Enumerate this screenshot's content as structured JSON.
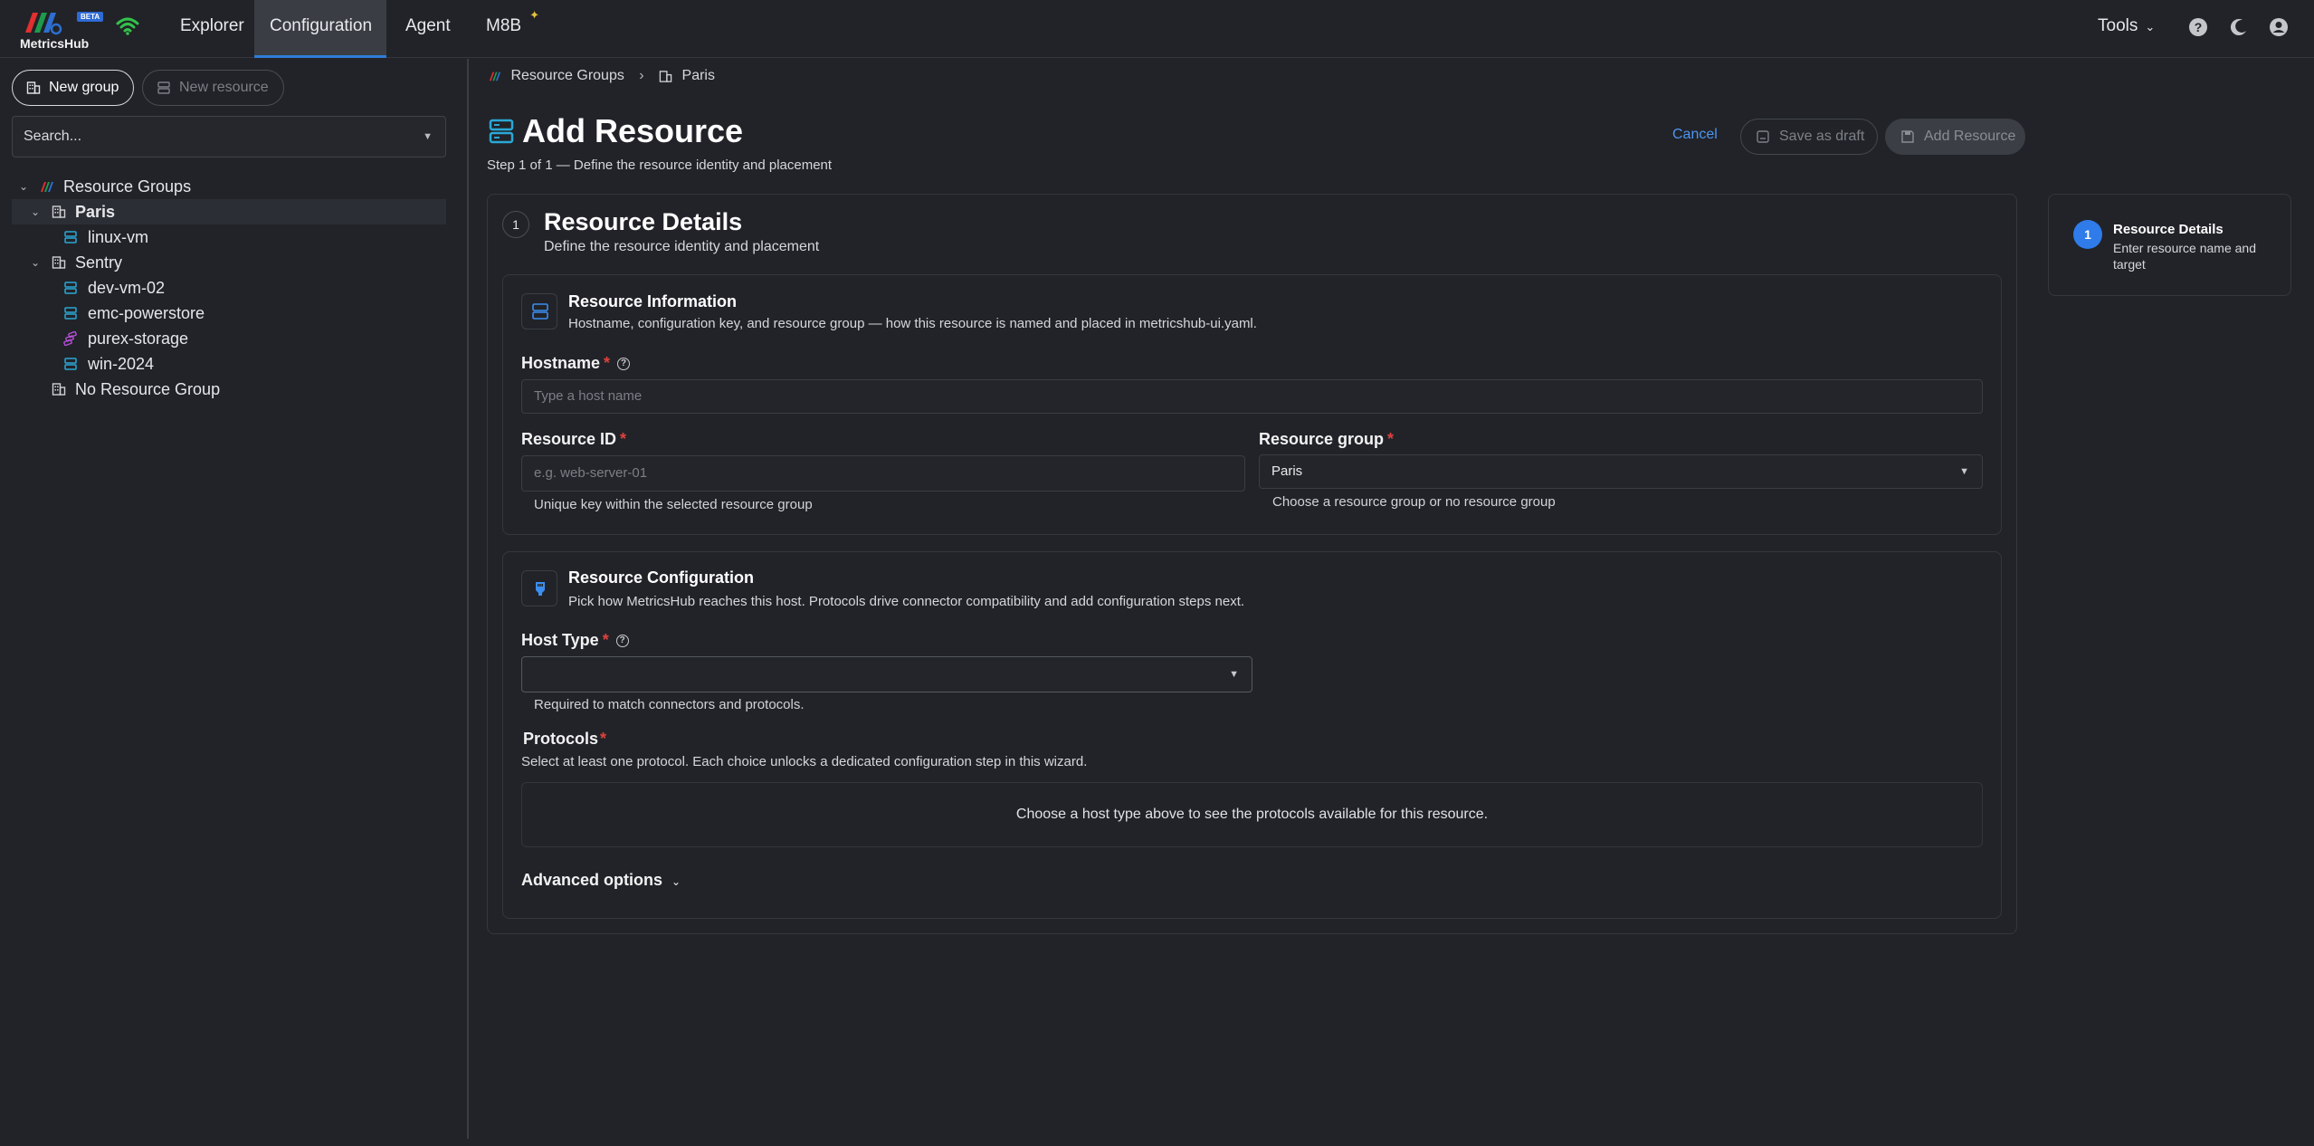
{
  "app": {
    "logo_text": "MetricsHub",
    "beta_badge": "BETA"
  },
  "nav": {
    "items": [
      {
        "label": "Explorer"
      },
      {
        "label": "Configuration"
      },
      {
        "label": "Agent"
      },
      {
        "label": "M8B"
      }
    ],
    "active": "Configuration",
    "tools_label": "Tools"
  },
  "sidebar": {
    "new_group_label": "New group",
    "new_resource_label": "New resource",
    "search_placeholder": "Search...",
    "tree": [
      {
        "label": "Resource Groups",
        "icon": "resource-groups-logo-icon"
      },
      {
        "label": "Paris",
        "icon": "building-icon",
        "selected": true
      },
      {
        "label": "linux-vm",
        "icon": "server-icon"
      },
      {
        "label": "Sentry",
        "icon": "building-icon"
      },
      {
        "label": "dev-vm-02",
        "icon": "server-icon"
      },
      {
        "label": "emc-powerstore",
        "icon": "server-icon"
      },
      {
        "label": "purex-storage",
        "icon": "storage-icon"
      },
      {
        "label": "win-2024",
        "icon": "server-icon"
      },
      {
        "label": "No Resource Group",
        "icon": "building-icon"
      }
    ]
  },
  "breadcrumb": {
    "root": "Resource Groups",
    "current": "Paris"
  },
  "header": {
    "title": "Add Resource",
    "subtitle": "Step 1 of 1 — Define the resource identity and placement",
    "cancel_label": "Cancel",
    "save_draft_label": "Save as draft",
    "add_resource_label": "Add Resource"
  },
  "step": {
    "number": "1",
    "title": "Resource Details",
    "subtitle": "Define the resource identity and placement"
  },
  "resource_info": {
    "title": "Resource Information",
    "description": "Hostname, configuration key, and resource group — how this resource is named and placed in metricshub-ui.yaml.",
    "hostname_label": "Hostname",
    "hostname_placeholder": "Type a host name",
    "resource_id_label": "Resource ID",
    "resource_id_placeholder": "e.g. web-server-01",
    "resource_id_hint": "Unique key within the selected resource group",
    "resource_group_label": "Resource group",
    "resource_group_value": "Paris",
    "resource_group_hint": "Choose a resource group or no resource group"
  },
  "resource_config": {
    "title": "Resource Configuration",
    "description": "Pick how MetricsHub reaches this host. Protocols drive connector compatibility and add configuration steps next.",
    "host_type_label": "Host Type",
    "host_type_value": "",
    "host_type_hint": "Required to match connectors and protocols.",
    "protocols_label": "Protocols",
    "protocols_description": "Select at least one protocol. Each choice unlocks a dedicated configuration step in this wizard.",
    "protocols_empty": "Choose a host type above to see the protocols available for this resource.",
    "advanced_label": "Advanced options"
  },
  "stepper": {
    "number": "1",
    "title": "Resource Details",
    "subtitle": "Enter resource name and target"
  },
  "colors": {
    "accent": "#2f7bea",
    "required": "#e0413d",
    "server_icon": "#2aa8d6",
    "storage_icon": "#b54fd6"
  }
}
